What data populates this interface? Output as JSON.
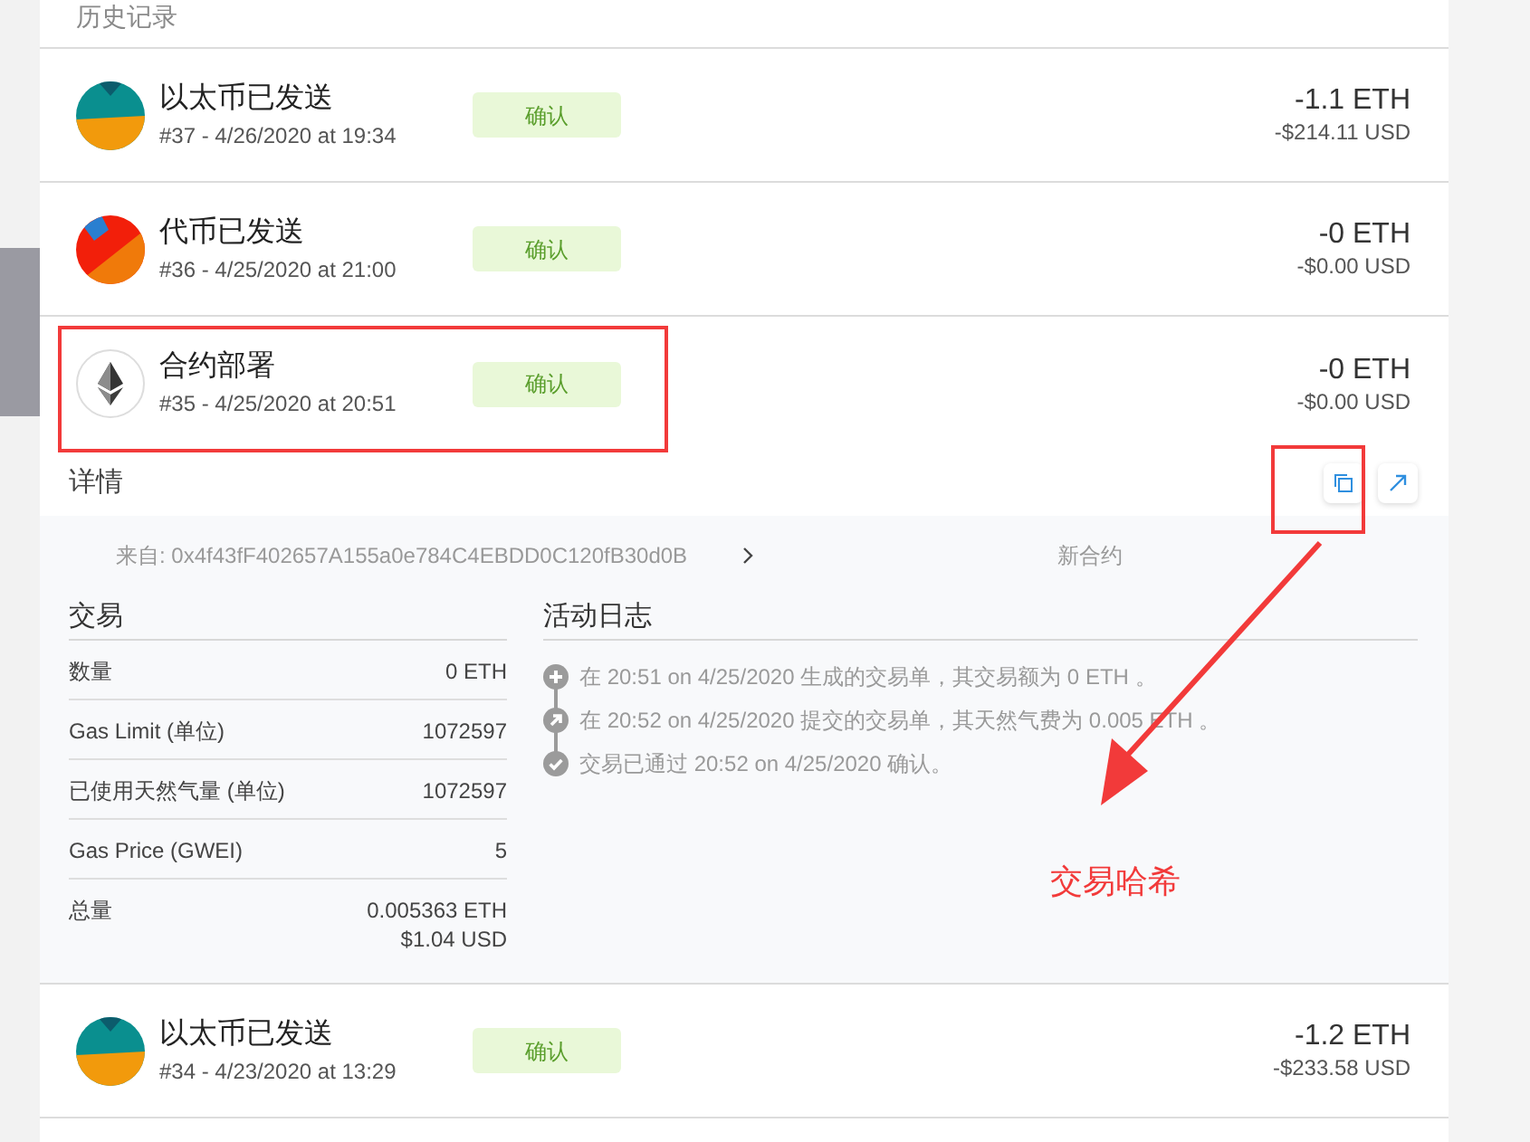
{
  "section_title": "历史记录",
  "transactions": [
    {
      "kind": "ether",
      "title": "以太币已发送",
      "subtitle": "#37 - 4/26/2020 at 19:34",
      "status": "确认",
      "amount": "-1.1 ETH",
      "fiat": "-$214.11 USD"
    },
    {
      "kind": "token",
      "title": "代币已发送",
      "subtitle": "#36 - 4/25/2020 at 21:00",
      "status": "确认",
      "amount": "-0 ETH",
      "fiat": "-$0.00 USD"
    },
    {
      "kind": "contract",
      "title": "合约部署",
      "subtitle": "#35 - 4/25/2020 at 20:51",
      "status": "确认",
      "amount": "-0 ETH",
      "fiat": "-$0.00 USD",
      "details": {
        "title": "详情",
        "from": "来自: 0x4f43fF402657A155a0e784C4EBDD0C120fB30d0B",
        "to": "新合约",
        "transaction_title": "交易",
        "rows": [
          {
            "label": "数量",
            "value": "0 ETH"
          },
          {
            "label": "Gas Limit (单位)",
            "value": "1072597"
          },
          {
            "label": "已使用天然气量 (单位)",
            "value": "1072597"
          },
          {
            "label": "Gas Price (GWEI)",
            "value": "5"
          },
          {
            "label": "总量",
            "value": "0.005363 ETH",
            "value_2": "$1.04 USD"
          }
        ],
        "activity_title": "活动日志",
        "activity": [
          {
            "kind": "created",
            "text": "在 20:51 on 4/25/2020 生成的交易单，其交易额为 0 ETH 。"
          },
          {
            "kind": "submitted",
            "text": "在 20:52 on 4/25/2020 提交的交易单，其天然气费为 0.005 ETH 。"
          },
          {
            "kind": "confirmed",
            "text": "交易已通过 20:52 on 4/25/2020 确认。"
          }
        ]
      }
    },
    {
      "kind": "ether",
      "title": "以太币已发送",
      "subtitle": "#34 - 4/23/2020 at 13:29",
      "status": "确认",
      "amount": "-1.2 ETH",
      "fiat": "-$233.58 USD"
    }
  ],
  "annotation": {
    "label": "交易哈希"
  }
}
